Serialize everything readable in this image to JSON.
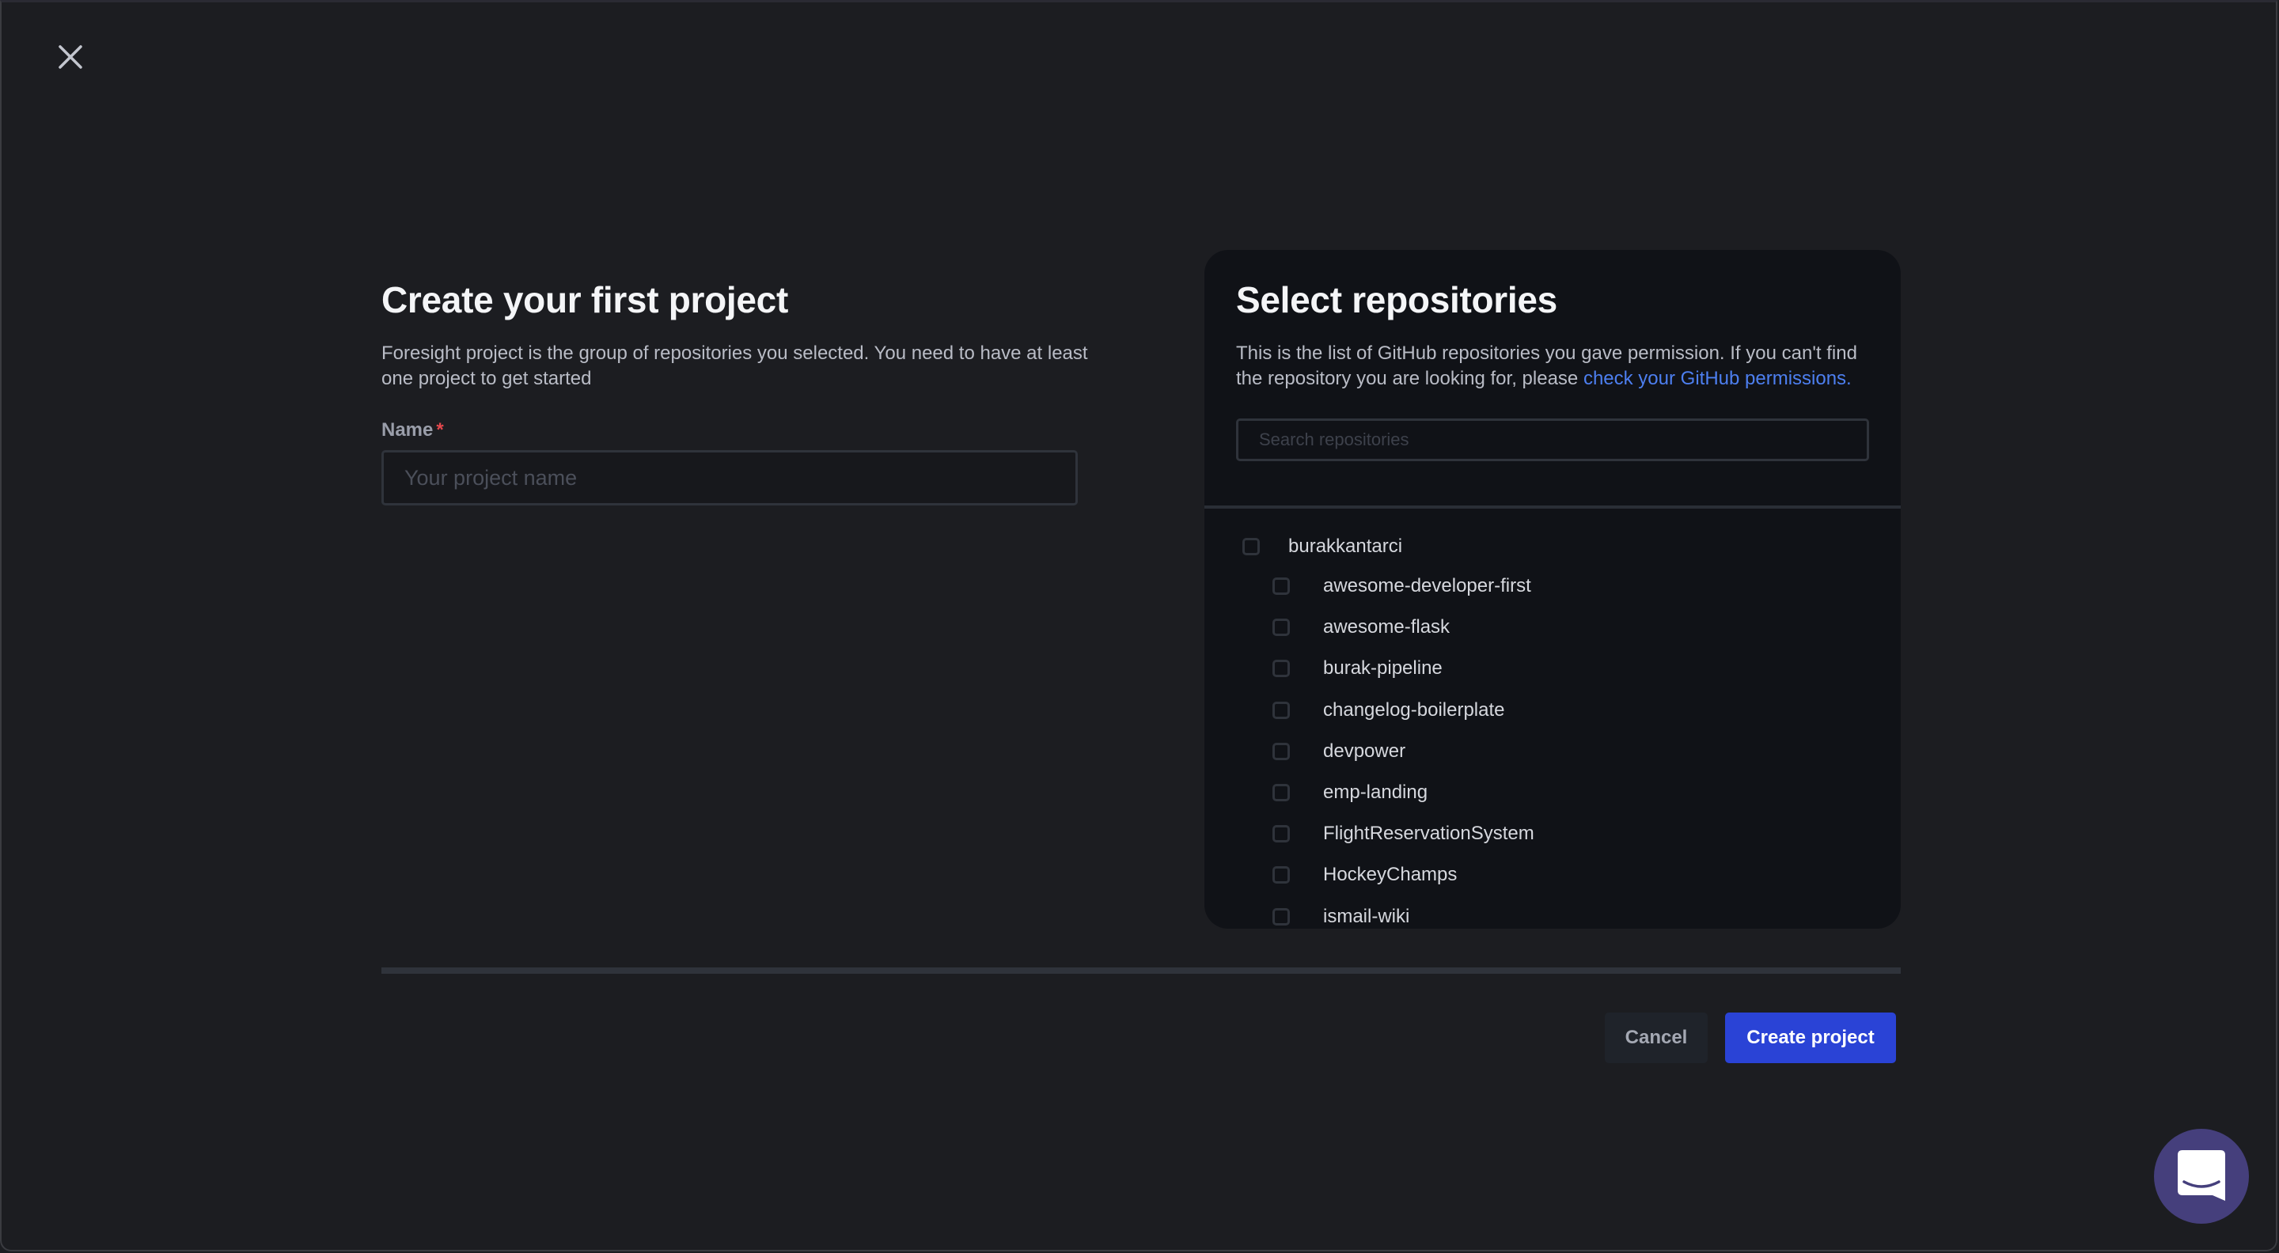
{
  "close": {
    "icon": "close-icon",
    "label": "Close"
  },
  "left": {
    "title": "Create your first project",
    "description": "Foresight project is the group of repositories you selected. You need to have at least one project to get started",
    "name_field": {
      "label": "Name",
      "required_mark": "*",
      "value": "",
      "placeholder": "Your project name"
    }
  },
  "panel": {
    "title": "Select repositories",
    "description_prefix": "This is the list of GitHub repositories you gave permission. If you can't find the repository you are looking for, please ",
    "link_text": "check your GitHub permissions.",
    "search": {
      "value": "",
      "placeholder": "Search repositories"
    },
    "owner": {
      "name": "burakkantarci",
      "checked": false
    },
    "repos": [
      {
        "name": "awesome-developer-first",
        "checked": false
      },
      {
        "name": "awesome-flask",
        "checked": false
      },
      {
        "name": "burak-pipeline",
        "checked": false
      },
      {
        "name": "changelog-boilerplate",
        "checked": false
      },
      {
        "name": "devpower",
        "checked": false
      },
      {
        "name": "emp-landing",
        "checked": false
      },
      {
        "name": "FlightReservationSystem",
        "checked": false
      },
      {
        "name": "HockeyChamps",
        "checked": false
      },
      {
        "name": "ismail-wiki",
        "checked": false
      }
    ]
  },
  "footer": {
    "cancel_label": "Cancel",
    "create_label": "Create project"
  },
  "colors": {
    "background": "#1c1d21",
    "panel": "#101217",
    "primary": "#2a43d6",
    "link": "#4d7ff0",
    "required": "#e5484d",
    "chat_widget": "#453f7c"
  },
  "chat_widget": {
    "icon": "chat-bubble-icon"
  }
}
